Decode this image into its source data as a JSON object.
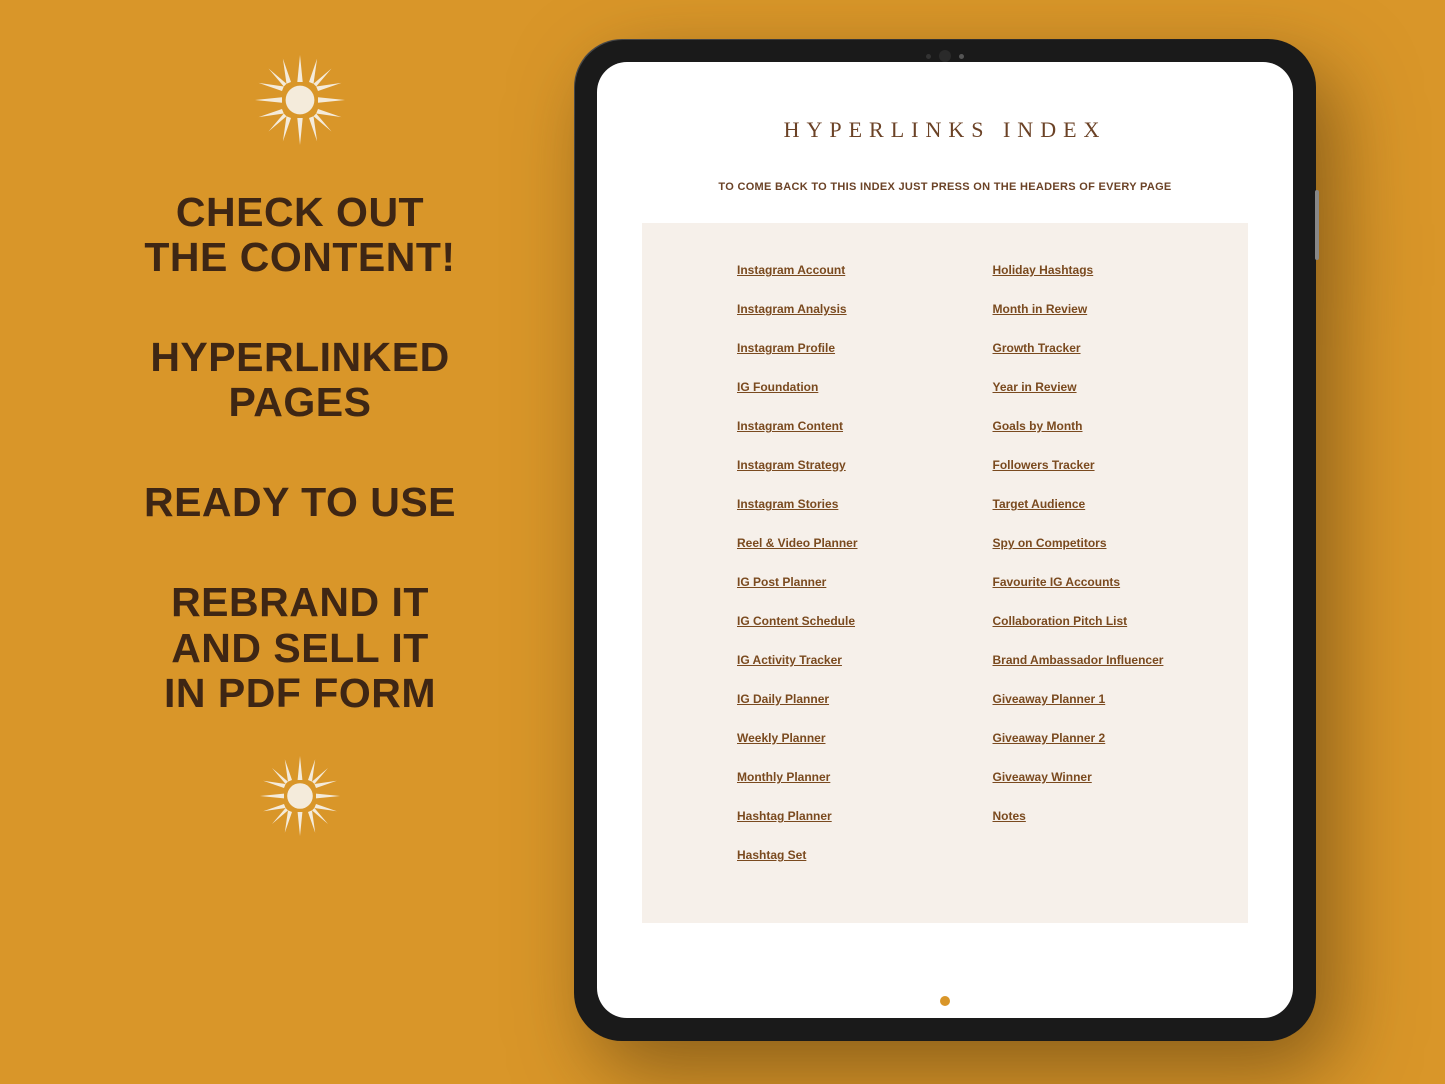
{
  "left": {
    "h1": "CHECK OUT\nTHE CONTENT!",
    "h2": "HYPERLINKED\nPAGES",
    "h3": "READY TO USE",
    "h4": "REBRAND IT\nAND SELL IT\nIN PDF FORM"
  },
  "screen": {
    "title": "HYPERLINKS INDEX",
    "subtitle": "TO COME BACK TO THIS INDEX JUST PRESS ON THE HEADERS OF EVERY PAGE",
    "col1": [
      "Instagram Account",
      "Instagram Analysis",
      "Instagram Profile",
      "IG Foundation",
      "Instagram Content",
      "Instagram Strategy",
      "Instagram Stories",
      "Reel & Video Planner",
      "IG Post Planner",
      "IG Content Schedule",
      "IG Activity Tracker",
      "IG Daily Planner",
      "Weekly Planner",
      "Monthly Planner",
      "Hashtag Planner",
      "Hashtag Set"
    ],
    "col2": [
      "Holiday Hashtags",
      "Month in Review",
      "Growth Tracker",
      "Year in Review",
      "Goals by Month",
      "Followers Tracker",
      "Target Audience",
      "Spy on Competitors",
      "Favourite IG Accounts",
      "Collaboration Pitch List",
      "Brand Ambassador Influencer",
      "Giveaway Planner 1",
      "Giveaway Planner 2",
      "Giveaway Winner",
      "Notes"
    ]
  }
}
